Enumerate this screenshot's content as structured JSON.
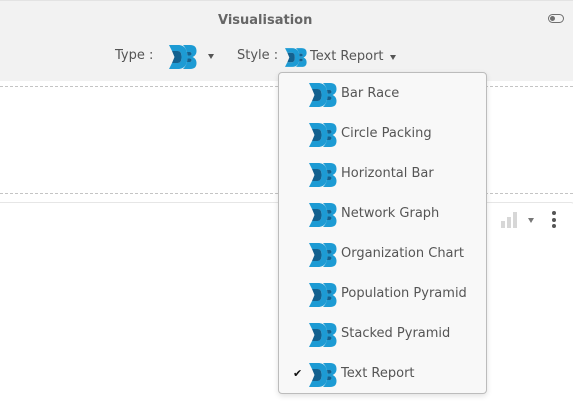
{
  "panel": {
    "title": "Visualisation",
    "toggle_icon": "toggle-icon",
    "type_label": "Type :",
    "type_icon": "d3-logo-icon",
    "style_label": "Style :",
    "style_value": "Text Report",
    "style_icon": "d3-logo-icon"
  },
  "dropdown": {
    "items": [
      {
        "label": "Bar Race",
        "icon": "d3-logo-icon",
        "selected": false
      },
      {
        "label": "Circle Packing",
        "icon": "d3-logo-icon",
        "selected": false
      },
      {
        "label": "Horizontal Bar",
        "icon": "d3-logo-icon",
        "selected": false
      },
      {
        "label": "Network Graph",
        "icon": "d3-logo-icon",
        "selected": false
      },
      {
        "label": "Organization Chart",
        "icon": "d3-logo-icon",
        "selected": false
      },
      {
        "label": "Population Pyramid",
        "icon": "d3-logo-icon",
        "selected": false
      },
      {
        "label": "Stacked Pyramid",
        "icon": "d3-logo-icon",
        "selected": false
      },
      {
        "label": "Text Report",
        "icon": "d3-logo-icon",
        "selected": true
      }
    ],
    "check_mark": "✔"
  },
  "card": {
    "chart_icon": "bar-chart-icon",
    "menu_icon": "kebab-menu-icon"
  },
  "colors": {
    "d3_light": "#f68e3a",
    "d3_dark": "#1b3a5c",
    "d3_blue": "#1f9bd1",
    "panel_bg": "#f2f2f2"
  }
}
